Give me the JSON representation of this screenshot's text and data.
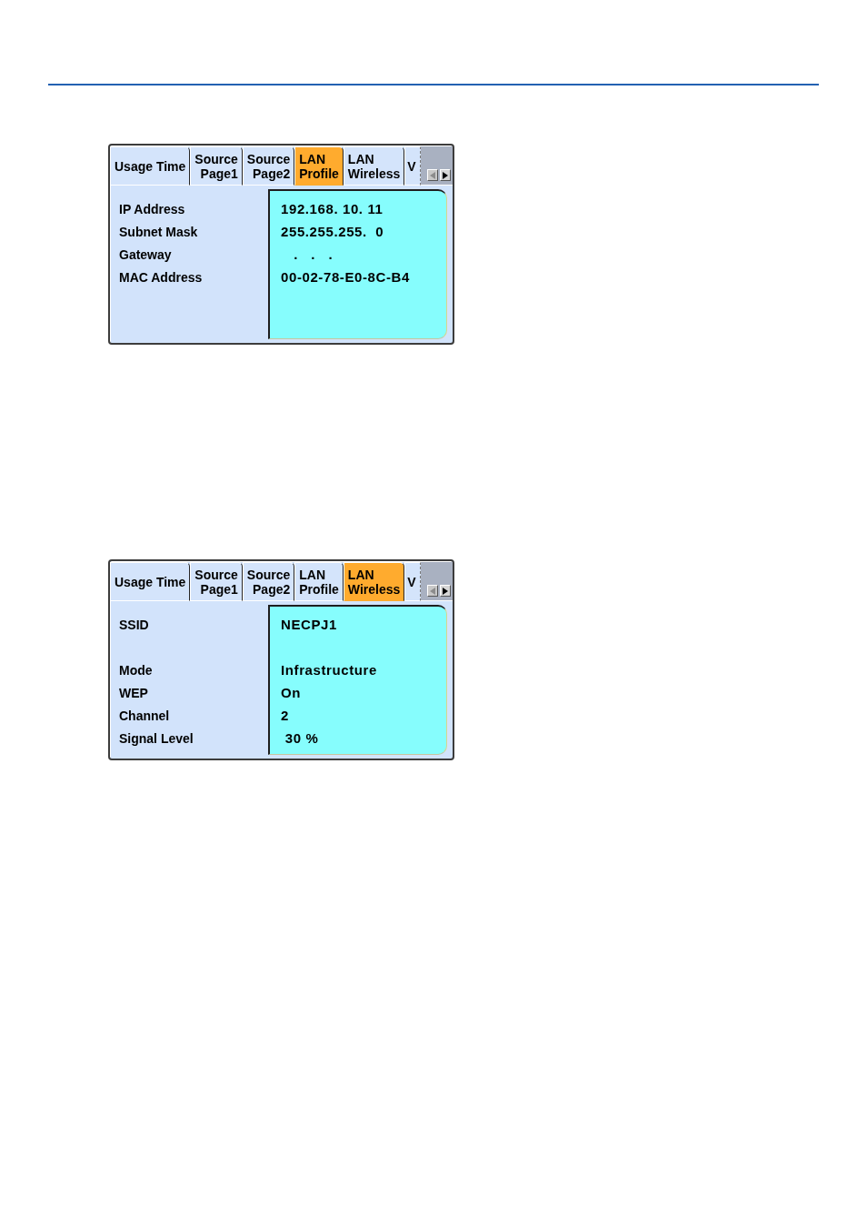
{
  "panels": [
    {
      "tabs": [
        {
          "label": "Usage Time",
          "kind": "full",
          "selected": false
        },
        {
          "label": "Source\nPage1",
          "kind": "full",
          "selected": false
        },
        {
          "label": "Source\nPage2",
          "kind": "full",
          "selected": false
        },
        {
          "label": "LAN\nProfile",
          "kind": "full",
          "selected": true
        },
        {
          "label": "LAN\nWireless",
          "kind": "full",
          "selected": false
        },
        {
          "label": "V",
          "kind": "cut",
          "selected": false
        }
      ],
      "scroll_buttons": [
        {
          "kind": "left",
          "disabled": true
        },
        {
          "kind": "right",
          "disabled": false
        }
      ],
      "sections": [
        {
          "rows": [
            {
              "label": "IP Address",
              "value": "192.168. 10. 11"
            },
            {
              "label": "Subnet Mask",
              "value": "255.255.255.  0"
            },
            {
              "label": "Gateway",
              "value": "   .   .   ."
            },
            {
              "label": "MAC Address",
              "value": "00-02-78-E0-8C-B4"
            }
          ]
        }
      ]
    },
    {
      "tabs": [
        {
          "label": "Usage Time",
          "kind": "full",
          "selected": false
        },
        {
          "label": "Source\nPage1",
          "kind": "full",
          "selected": false
        },
        {
          "label": "Source\nPage2",
          "kind": "full",
          "selected": false
        },
        {
          "label": "LAN\nProfile",
          "kind": "full",
          "selected": false
        },
        {
          "label": "LAN\nWireless",
          "kind": "full",
          "selected": true
        },
        {
          "label": "V",
          "kind": "cut",
          "selected": false
        }
      ],
      "scroll_buttons": [
        {
          "kind": "left",
          "disabled": true
        },
        {
          "kind": "right",
          "disabled": false
        }
      ],
      "sections": [
        {
          "rows": [
            {
              "label": "SSID",
              "value": "NECPJ1"
            }
          ]
        },
        {
          "rows": [
            {
              "label": "Mode",
              "value": "Infrastructure"
            },
            {
              "label": "WEP",
              "value": "On"
            },
            {
              "label": "Channel",
              "value": "2"
            },
            {
              "label": "Signal Level",
              "value": " 30 %"
            }
          ]
        }
      ]
    }
  ]
}
